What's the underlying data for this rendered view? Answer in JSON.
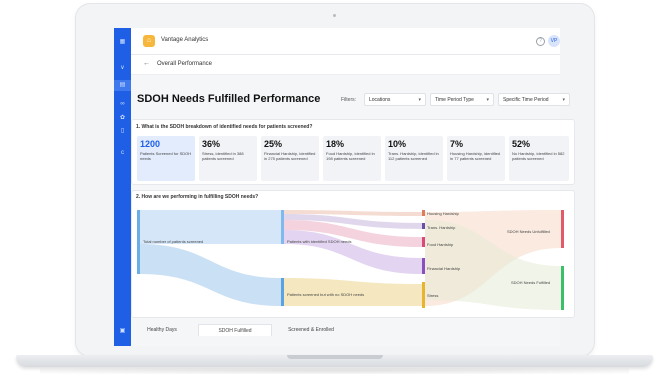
{
  "app": {
    "title": "Vantage Analytics",
    "logo_glyph": "⌂",
    "help_glyph": "?",
    "user_initials": "VP"
  },
  "sidebar": {
    "icons": [
      "grid-icon",
      "chevron-icon",
      "dashboard-icon",
      "link-icon",
      "gear-icon",
      "document-icon",
      "info-icon",
      "bottom-menu-icon"
    ]
  },
  "breadcrumb": {
    "back_glyph": "←",
    "label": "Overall Performance"
  },
  "page": {
    "title": "SDOH Needs Fulfilled Performance"
  },
  "filters": {
    "label": "Filters:",
    "items": [
      {
        "label": "Locations"
      },
      {
        "label": "Time Period Type"
      },
      {
        "label": "Specific Time Period"
      }
    ],
    "chevron": "▾"
  },
  "section1": {
    "question": "1. What is the SDOH breakdown of identified needs for patients screened?",
    "stats": [
      {
        "value": "1200",
        "text": "Patients Screened for SDOH needs"
      },
      {
        "value": "36%",
        "text": "Stress, identified in 388 patients screened"
      },
      {
        "value": "25%",
        "text": "Financial Hardship, identified in 275 patients screened"
      },
      {
        "value": "18%",
        "text": "Food Hardship, identified in 198 patients screened"
      },
      {
        "value": "10%",
        "text": "Trans. Hardship, identified in 112 patients screened"
      },
      {
        "value": "7%",
        "text": "Housing Hardship, identified in 77 patients screened"
      },
      {
        "value": "52%",
        "text": "No Hardship, identified in 582 patients screened"
      }
    ]
  },
  "section2": {
    "question": "2. How are we performing in fulfilling SDOH needs?",
    "nodes": {
      "total": "Total number of patients screened",
      "identified": "Patients with identified SDOH needs",
      "no_needs": "Patients screened but with no SDOH needs",
      "housing": "Housing Hardship",
      "trans": "Trans. Hardship",
      "food": "Food Hardship",
      "financial": "Financial Hardship",
      "stress": "Stress",
      "unfulfilled": "SDOH Needs Unfulfilled",
      "fulfilled": "SDOH Needs Fulfilled"
    },
    "colors": {
      "total": "#6aaee8",
      "identified": "#7fb9ee",
      "no_needs": "#5aa2e2",
      "housing": "#e07a5f",
      "trans": "#6a4ea8",
      "food": "#d94a7a",
      "financial": "#8a4fc0",
      "stress": "#e8b42c",
      "unfulfilled": "#e05a6a",
      "fulfilled": "#3cbf6a"
    }
  },
  "tabs": [
    {
      "label": "Healthy Days"
    },
    {
      "label": "SDOH Fulfilled"
    },
    {
      "label": "Screened & Enrolled"
    }
  ]
}
